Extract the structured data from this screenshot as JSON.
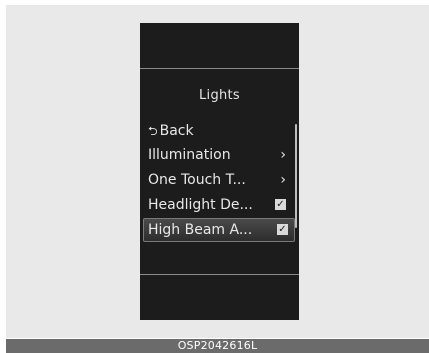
{
  "screen": {
    "title": "Lights",
    "menu": [
      {
        "label": "Back",
        "icon": "back-arrow-icon",
        "right": ""
      },
      {
        "label": "Illumination",
        "right": "chevron-right-icon"
      },
      {
        "label": "One Touch T...",
        "right": "chevron-right-icon"
      },
      {
        "label": "Headlight De...",
        "right": "checkbox-checked-icon"
      },
      {
        "label": "High Beam A...",
        "right": "checkbox-checked-icon",
        "selected": true
      }
    ],
    "chevron_glyph": "›",
    "check_glyph": "✓",
    "back_glyph": "⮌"
  },
  "caption": "OSP2042616L",
  "colors": {
    "screen_bg": "#1c1c1c",
    "text": "#e8e8e8",
    "divider": "#8a8a8a",
    "page_bg": "#e9e9e9",
    "caption_bar": "#6b6b6b"
  }
}
